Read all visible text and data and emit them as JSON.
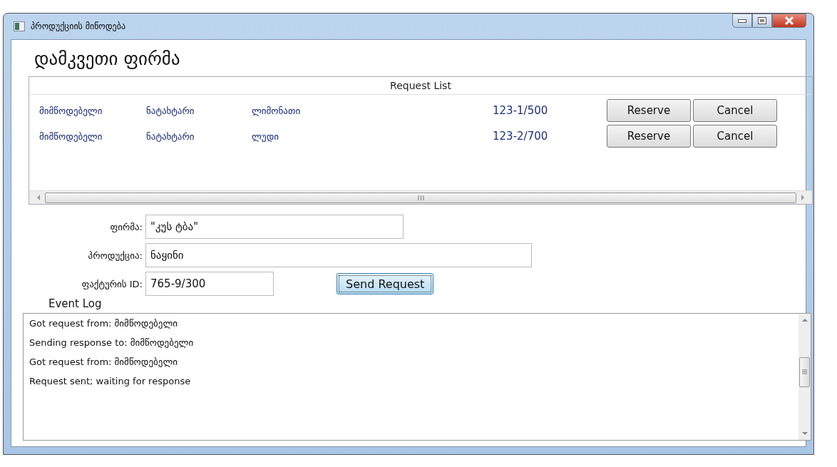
{
  "window": {
    "title": "პროდუქციის მიწოდება"
  },
  "heading": "დამკვეთი ფირმა",
  "request_list": {
    "title": "Request List",
    "rows": [
      {
        "sender": "მიმწოდებელი",
        "company": "ნატახტარი",
        "product": "ლიმონათი",
        "invoice": "123-1/500",
        "buttons": [
          "Reserve",
          "Cancel"
        ]
      },
      {
        "sender": "მიმწოდებელი",
        "company": "ნატახტარი",
        "product": "ლუდი",
        "invoice": "123-2/700",
        "buttons": [
          "Reserve",
          "Cancel"
        ]
      }
    ]
  },
  "form": {
    "fields": [
      {
        "label": "ფირმა:",
        "value": "\"კუს ტბა\""
      },
      {
        "label": "პროდუქცია:",
        "value": "ნაყინი"
      },
      {
        "label": "ფაქტურის ID:",
        "value": "765-9/300"
      }
    ],
    "send_button": "Send Request"
  },
  "event_log": {
    "title": "Event Log",
    "lines": [
      "Got request from: მიმწოდებელი",
      "Sending response to: მიმწოდებელი",
      "Got request from: მიმწოდებელი",
      "Request sent; waiting for response"
    ]
  }
}
